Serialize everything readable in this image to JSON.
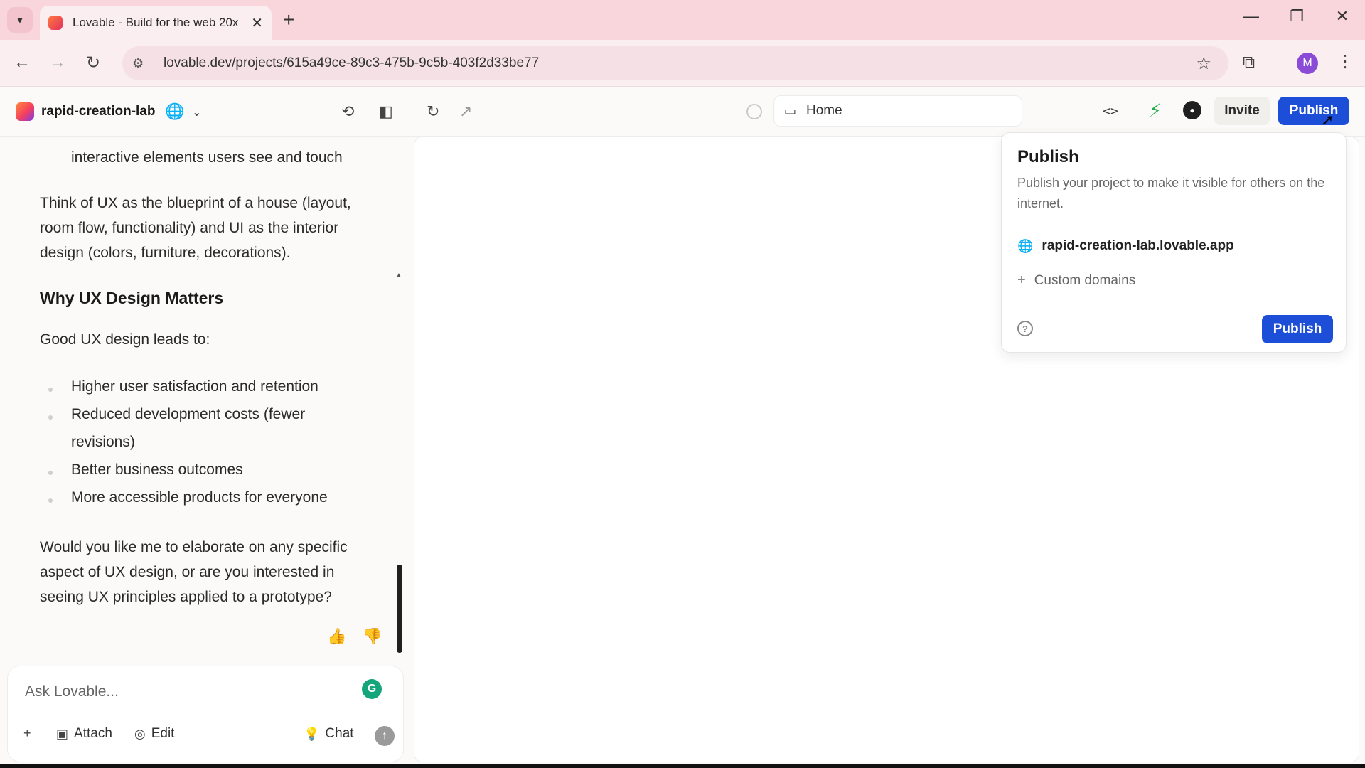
{
  "browser": {
    "tab_title": "Lovable - Build for the web 20x",
    "url": "lovable.dev/projects/615a49ce-89c3-475b-9c5b-403f2d33be77",
    "profile_initial": "M"
  },
  "header": {
    "project_name": "rapid-creation-lab",
    "route": "Home",
    "invite_label": "Invite",
    "publish_label": "Publish"
  },
  "chat": {
    "line_fragment": "interactive elements users see and touch",
    "analogy": "Think of UX as the blueprint of a house (layout, room flow, functionality) and UI as the interior design (colors, furniture, decorations).",
    "heading": "Why UX Design Matters",
    "intro": "Good UX design leads to:",
    "benefits": [
      "Higher user satisfaction and retention",
      "Reduced development costs (fewer revisions)",
      "Better business outcomes",
      "More accessible products for everyone"
    ],
    "question": "Would you like me to elaborate on any specific aspect of UX design, or are you interested in seeing UX principles applied to a prototype?"
  },
  "composer": {
    "placeholder": "Ask Lovable...",
    "attach_label": "Attach",
    "edit_label": "Edit",
    "chat_label": "Chat"
  },
  "publish_popover": {
    "title": "Publish",
    "description": "Publish your project to make it visible for others on the internet.",
    "domain": "rapid-creation-lab.lovable.app",
    "custom_domains_label": "Custom domains",
    "publish_button": "Publish"
  },
  "colors": {
    "accent": "#1d4ed8",
    "tabstrip": "#f9d6dc"
  }
}
